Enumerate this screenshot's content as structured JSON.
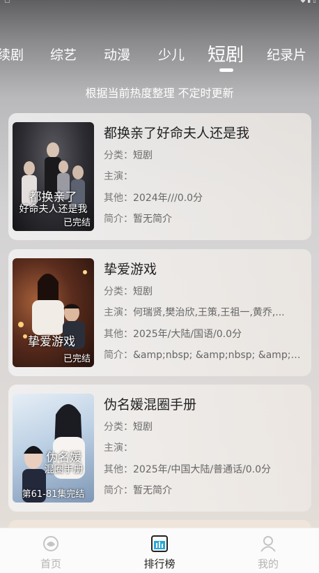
{
  "tabs": [
    "续剧",
    "综艺",
    "动漫",
    "少儿",
    "短剧",
    "纪录片"
  ],
  "active_tab": "短剧",
  "subtitle": "根据当前热度整理 不定时更新",
  "labels": {
    "category": "分类：",
    "cast": "主演：",
    "other": "其他：",
    "intro": "简介："
  },
  "items": [
    {
      "title": "都换亲了好命夫人还是我",
      "poster_title_line1": "都换亲了",
      "poster_title_line2": "好命夫人还是我",
      "status": "已完结",
      "category": "短剧",
      "cast": "",
      "other": "2024年///0.0分",
      "intro": "暂无简介"
    },
    {
      "title": "挚爱游戏",
      "poster_title_line1": "挚爱游戏",
      "poster_title_line2": "",
      "status": "已完结",
      "category": "短剧",
      "cast": "何瑞贤,樊治欣,王策,王祖一,黄乔,...",
      "other": "2025年/大陆/国语/0.0分",
      "intro": "&amp;nbsp; &amp;nbsp; &amp;nb..."
    },
    {
      "title": "伪名媛混圈手册",
      "poster_title_line1": "伪名媛",
      "poster_title_line2": "混圈手册",
      "status": "第61-81集完结",
      "category": "短剧",
      "cast": "",
      "other": "2025年/中国大陆/普通话/0.0分",
      "intro": "暂无简介"
    }
  ],
  "nav": [
    {
      "label": "首页",
      "icon": "home-icon"
    },
    {
      "label": "排行榜",
      "icon": "ranking-icon"
    },
    {
      "label": "我的",
      "icon": "profile-icon"
    }
  ],
  "colors": {
    "active_nav": "#222222",
    "inactive_nav": "#b4b4b4",
    "ranking_icon": "#2aa8d8"
  }
}
